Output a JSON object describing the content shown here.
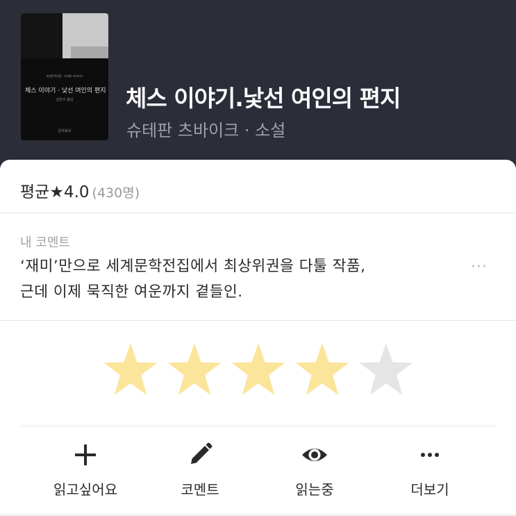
{
  "book": {
    "cover": {
      "series_small_text": "세계문학전집 · 슈테판 츠바이크",
      "title_text": "체스 이야기 · 낯선 여인의 편지",
      "author_text": "김연수 옮김",
      "publisher_text": "문학동네"
    },
    "title": "체스 이야기.낯선 여인의 편지",
    "subtitle": "슈테판 츠바이크 · 소설"
  },
  "rating": {
    "average_label": "평균",
    "star_glyph": "★",
    "average_value": "4.0",
    "count_text": "(430명)"
  },
  "my_comment": {
    "label": "내 코멘트",
    "lines": [
      "‘재미’만으로 세계문학전집에서 최상위권을 다툴 작품,",
      "근데 이제 묵직한 여운까지 곁들인."
    ],
    "more_glyph": "···"
  },
  "my_rating": {
    "value": 4,
    "max": 5,
    "filled_color": "#fbe59a",
    "empty_color": "#e5e5e5"
  },
  "actions": [
    {
      "label": "읽고싶어요",
      "icon": "plus-icon"
    },
    {
      "label": "코멘트",
      "icon": "pencil-icon"
    },
    {
      "label": "읽는중",
      "icon": "eye-icon"
    },
    {
      "label": "더보기",
      "icon": "more-dots-icon"
    }
  ],
  "colors": {
    "header_bg": "#2b2d38",
    "text_primary": "#2a2a2a",
    "text_muted": "#999999"
  }
}
